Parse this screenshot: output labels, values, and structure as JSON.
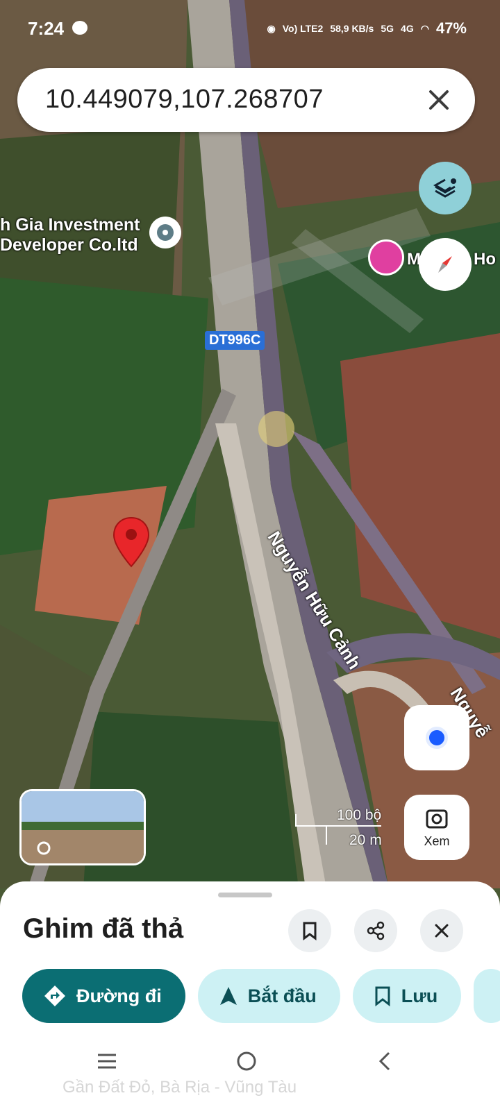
{
  "status": {
    "time": "7:24",
    "network": "Vo) LTE2",
    "speed": "58,9 KB/s",
    "sig1": "5G",
    "sig2": "4G",
    "battery": "47%"
  },
  "search": {
    "query": "10.449079,107.268707"
  },
  "map": {
    "place_label_line1": "h Gia Investment",
    "place_label_line2": "Developer Co.ltd",
    "poi_label": "M",
    "poi_label_right": "Ho",
    "road_shield": "DT996C",
    "street_1": "Nguyễn Hữu Cảnh",
    "street_2": "Nguyễ",
    "scale_top": "100 bộ",
    "scale_bottom": "20 m"
  },
  "buttons": {
    "xem": "Xem"
  },
  "sheet": {
    "title": "Ghim đã thả",
    "chips": [
      {
        "label": "Đường đi",
        "icon": "directions-icon"
      },
      {
        "label": "Bắt đầu",
        "icon": "navigation-arrow-icon"
      },
      {
        "label": "Lưu",
        "icon": "bookmark-icon"
      }
    ],
    "behind_text": "Gần Đất Đỏ, Bà Rịa - Vũng Tàu"
  },
  "colors": {
    "accent": "#0b6e73",
    "chip_bg": "#cdf1f4",
    "pin": "#e8262a",
    "layers_bg": "#8fd0d8"
  }
}
